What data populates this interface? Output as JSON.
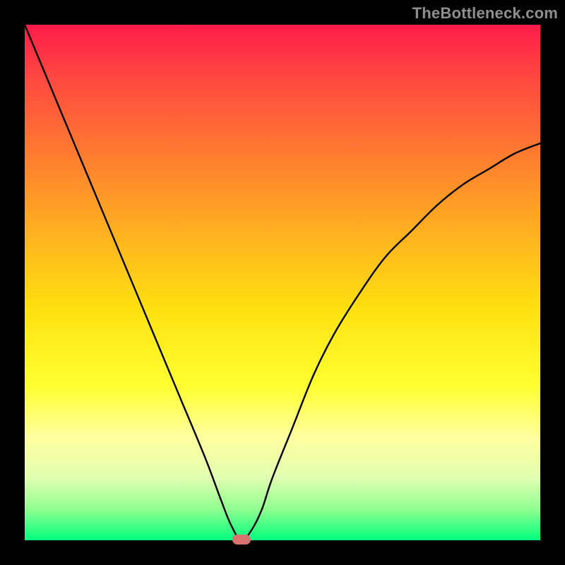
{
  "watermark": "TheBottleneck.com",
  "chart_data": {
    "type": "line",
    "title": "",
    "xlabel": "",
    "ylabel": "",
    "xlim": [
      0,
      100
    ],
    "ylim": [
      0,
      100
    ],
    "grid": false,
    "legend": false,
    "series": [
      {
        "name": "bottleneck-curve",
        "x": [
          0,
          5,
          10,
          15,
          20,
          25,
          30,
          35,
          38,
          40,
          42,
          44,
          46,
          48,
          52,
          56,
          60,
          65,
          70,
          75,
          80,
          85,
          90,
          95,
          100
        ],
        "y": [
          100,
          88,
          76,
          64,
          52,
          40,
          28,
          16,
          8,
          3,
          0,
          2,
          6,
          12,
          22,
          32,
          40,
          48,
          55,
          60,
          65,
          69,
          72,
          75,
          77
        ]
      }
    ],
    "annotations": [
      {
        "name": "optimal-marker",
        "x": 42,
        "y": 0
      }
    ],
    "background_gradient": {
      "top": "#ff1b4a",
      "bottom": "#00ff7d"
    }
  }
}
